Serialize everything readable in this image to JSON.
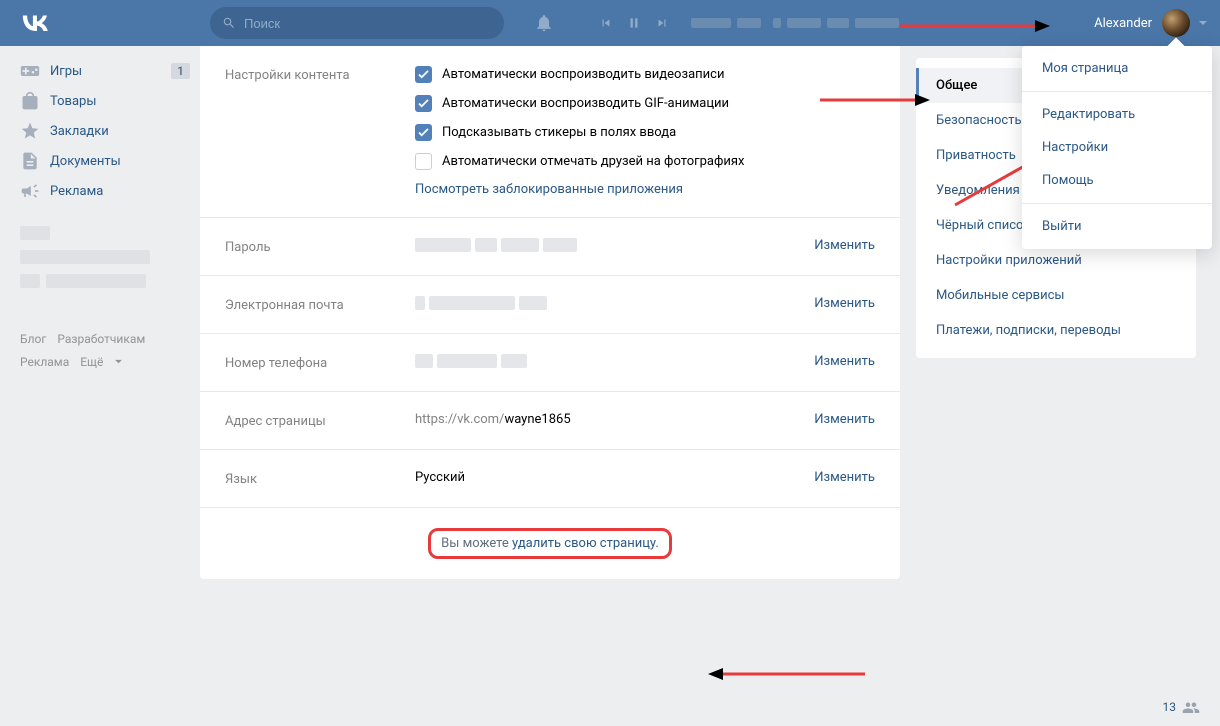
{
  "header": {
    "search_placeholder": "Поиск",
    "user_name": "Alexander"
  },
  "sidebar": {
    "items": [
      {
        "label": "Игры",
        "icon": "games",
        "badge": "1"
      },
      {
        "label": "Товары",
        "icon": "market"
      },
      {
        "label": "Закладки",
        "icon": "bookmark"
      },
      {
        "label": "Документы",
        "icon": "docs"
      },
      {
        "label": "Реклама",
        "icon": "ads"
      }
    ]
  },
  "footer": {
    "blog": "Блог",
    "devs": "Разработчикам",
    "ads": "Реклама",
    "more": "Ещё"
  },
  "content": {
    "settings_label": "Настройки контента",
    "cb1": "Автоматически воспроизводить видеозаписи",
    "cb2": "Автоматически воспроизводить GIF-анимации",
    "cb3": "Подсказывать стикеры в полях ввода",
    "cb4": "Автоматически отмечать друзей на фотографиях",
    "blocked_apps": "Посмотреть заблокированные приложения",
    "password_label": "Пароль",
    "email_label": "Электронная почта",
    "phone_label": "Номер телефона",
    "address_label": "Адрес страницы",
    "address_prefix": "https://vk.com/",
    "address_value": "wayne1865",
    "language_label": "Язык",
    "language_value": "Русский",
    "change": "Изменить",
    "delete_prefix": "Вы можете ",
    "delete_link": "удалить свою страницу."
  },
  "right_tabs": [
    "Общее",
    "Безопасность",
    "Приватность",
    "Уведомления",
    "Чёрный список",
    "Настройки приложений",
    "Мобильные сервисы",
    "Платежи, подписки, переводы"
  ],
  "dropdown": {
    "my_page": "Моя страница",
    "edit": "Редактировать",
    "settings": "Настройки",
    "help": "Помощь",
    "logout": "Выйти"
  },
  "chat_count": "13"
}
